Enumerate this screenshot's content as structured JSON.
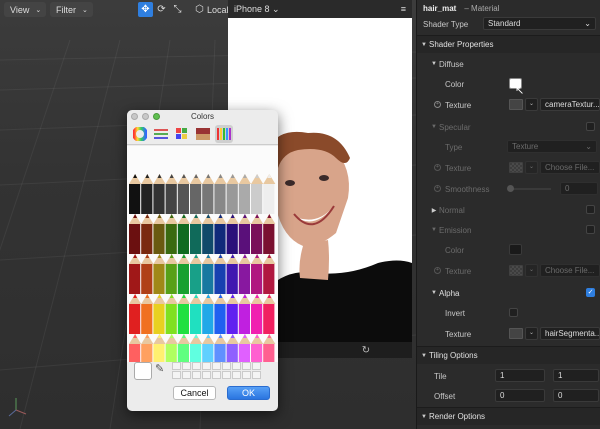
{
  "toolbar": {
    "view_label": "View",
    "filter_label": "Filter",
    "local_label": "Local"
  },
  "preview": {
    "device": "iPhone 8"
  },
  "colors_dialog": {
    "title": "Colors",
    "cancel_label": "Cancel",
    "ok_label": "OK"
  },
  "inspector": {
    "asset_name": "hair_mat",
    "asset_type": "– Material",
    "shader_type_label": "Shader Type",
    "shader_type_value": "Standard",
    "shader_properties_label": "Shader Properties",
    "diffuse": {
      "label": "Diffuse",
      "color_label": "Color",
      "texture_label": "Texture",
      "texture_value": "cameraTextur..."
    },
    "specular": {
      "label": "Specular",
      "type_label": "Type",
      "type_value": "Texture",
      "texture_label": "Texture",
      "texture_value": "Choose File...",
      "smoothness_label": "Smoothness",
      "smoothness_value": "0"
    },
    "normal_label": "Normal",
    "emission": {
      "label": "Emission",
      "color_label": "Color",
      "texture_label": "Texture",
      "texture_value": "Choose File..."
    },
    "alpha": {
      "label": "Alpha",
      "invert_label": "Invert",
      "texture_label": "Texture",
      "texture_value": "hairSegmenta..."
    },
    "tiling": {
      "label": "Tiling Options",
      "tile_label": "Tile",
      "tile_x": "1",
      "tile_y": "1",
      "offset_label": "Offset",
      "offset_x": "0",
      "offset_y": "0"
    },
    "render_options_label": "Render Options"
  },
  "colors": {
    "accent": "#2f7fe0",
    "panel_bg": "#2b2b2b"
  }
}
